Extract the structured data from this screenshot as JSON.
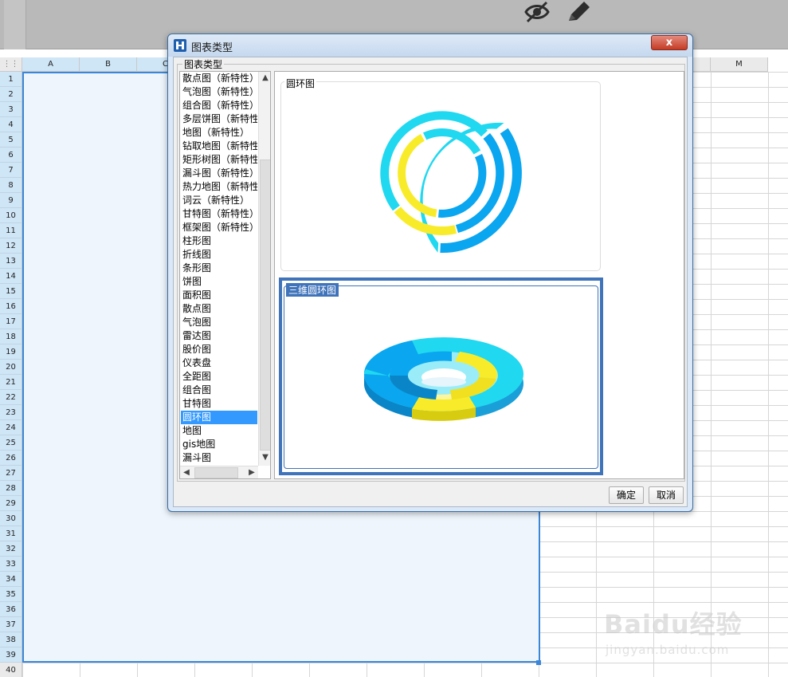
{
  "sheet": {
    "columns": [
      "A",
      "B",
      "C",
      "",
      "",
      "",
      "",
      "",
      "",
      "",
      "",
      "",
      "M"
    ],
    "rows": [
      "1",
      "2",
      "3",
      "4",
      "5",
      "6",
      "7",
      "8",
      "9",
      "10",
      "11",
      "12",
      "13",
      "14",
      "15",
      "16",
      "17",
      "18",
      "19",
      "20",
      "21",
      "22",
      "23",
      "24",
      "25",
      "26",
      "27",
      "28",
      "29",
      "30",
      "31",
      "32",
      "33",
      "34",
      "35",
      "36",
      "37",
      "38",
      "39",
      "40"
    ]
  },
  "toolbar": {
    "icons": [
      "eye-slash-icon",
      "pencil-icon"
    ]
  },
  "dialog": {
    "title": "图表类型",
    "group_label": "图表类型",
    "chart_types": [
      "散点图（新特性）",
      "气泡图（新特性）",
      "组合图（新特性）",
      "多层饼图（新特性",
      "地图（新特性）",
      "钻取地图（新特性）",
      "矩形树图（新特性",
      "漏斗图（新特性）",
      "热力地图（新特性）",
      "词云（新特性）",
      "甘特图（新特性）",
      "框架图（新特性）",
      "柱形图",
      "折线图",
      "条形图",
      "饼图",
      "面积图",
      "散点图",
      "气泡图",
      "雷达图",
      "股价图",
      "仪表盘",
      "全距图",
      "组合图",
      "甘特图",
      "圆环图",
      "地图",
      "gis地图",
      "漏斗图"
    ],
    "selected_type": "圆环图",
    "previews": [
      {
        "label": "圆环图",
        "selected": false
      },
      {
        "label": "三维圆环图",
        "selected": true
      }
    ],
    "ok_label": "确定",
    "cancel_label": "取消",
    "close_label": "x"
  },
  "colors": {
    "ring_cyan": "#20d8f0",
    "ring_blue": "#0aa6f0",
    "ring_yellow": "#f8ec2a",
    "selection": "#3399ff",
    "selected_border": "#3f73ba"
  },
  "watermark": {
    "logo": "Baidu经验",
    "url": "jingyan.baidu.com"
  }
}
